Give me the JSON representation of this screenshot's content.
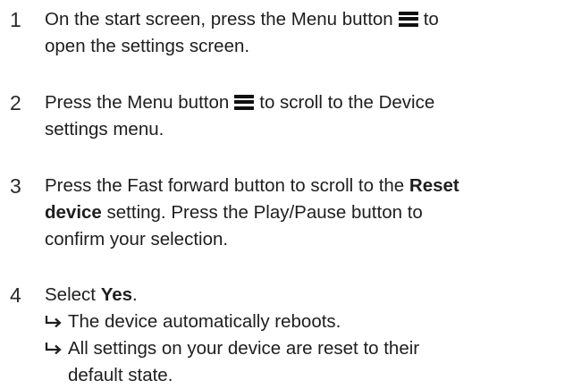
{
  "steps": [
    {
      "number": "1",
      "line1_a": "On the start screen, press the Menu button",
      "line1_b": "to",
      "line2": "open the settings screen.",
      "icon": "menu-icon"
    },
    {
      "number": "2",
      "line1_a": "Press the Menu button",
      "line1_b": "to scroll to the Device",
      "line2": "settings menu.",
      "icon": "menu-icon"
    },
    {
      "number": "3",
      "line1_a": "Press the Fast forward button to scroll to the",
      "line1_bold": "Reset",
      "line2_bold": "device",
      "line2_b": "setting. Press the Play/Pause button to",
      "line3": "confirm your selection."
    },
    {
      "number": "4",
      "line1_a": "Select",
      "line1_bold": "Yes",
      "line1_end": ".",
      "results": [
        {
          "line1": "The device automatically reboots."
        },
        {
          "line1": "All settings on your device are reset to their",
          "line2": "default state."
        }
      ],
      "result_icon": "result-arrow-icon"
    }
  ]
}
